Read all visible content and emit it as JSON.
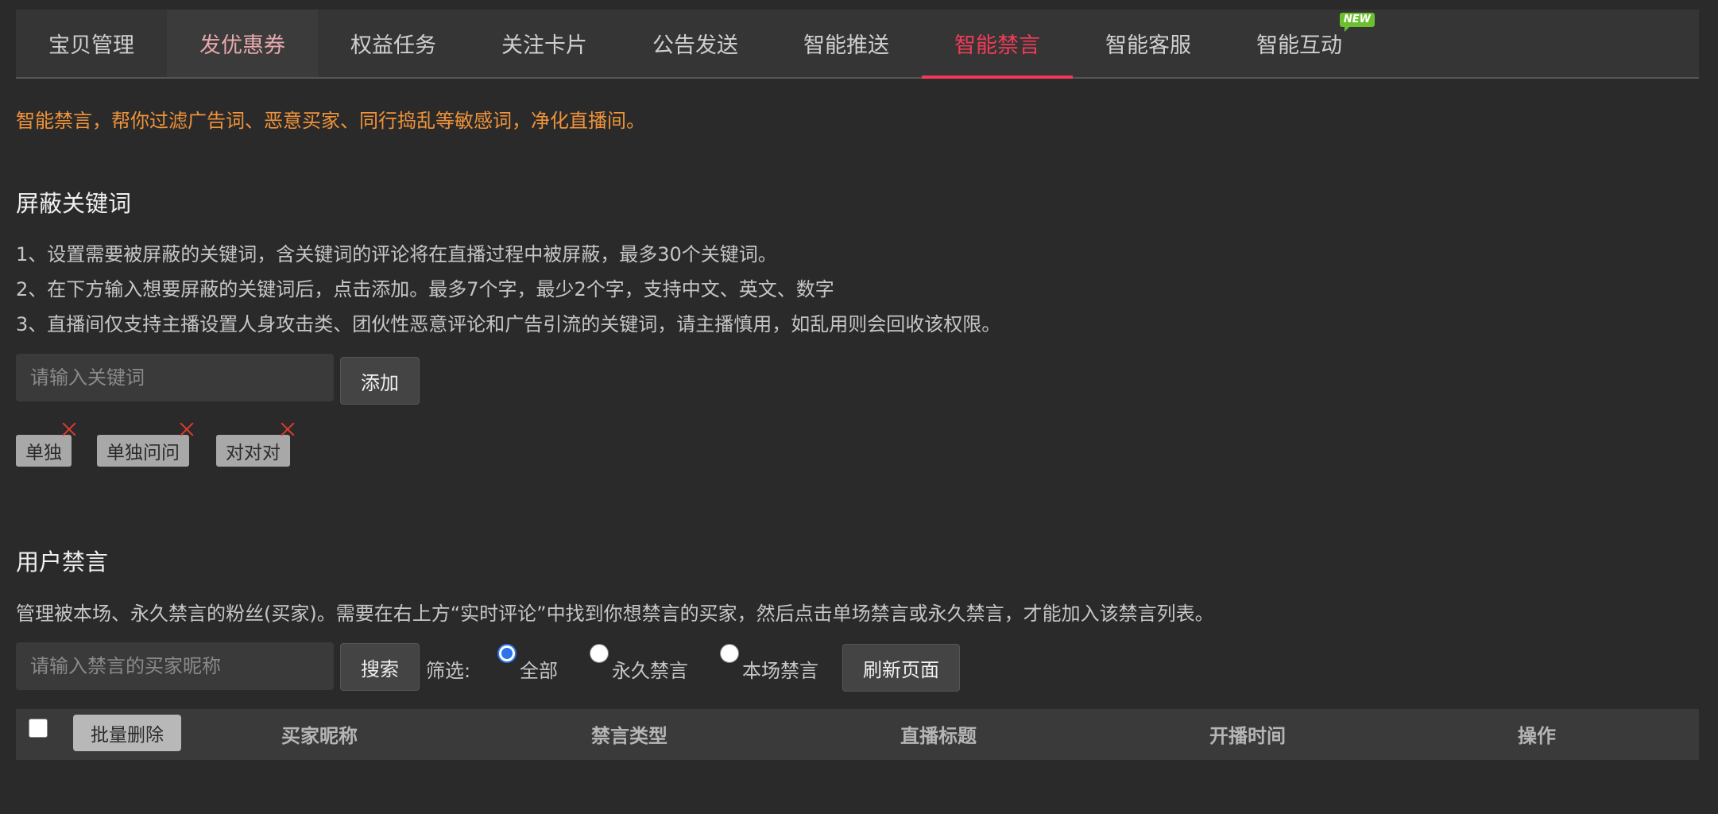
{
  "tabs": [
    {
      "label": "宝贝管理"
    },
    {
      "label": "发优惠券"
    },
    {
      "label": "权益任务"
    },
    {
      "label": "关注卡片"
    },
    {
      "label": "公告发送"
    },
    {
      "label": "智能推送"
    },
    {
      "label": "智能禁言"
    },
    {
      "label": "智能客服"
    },
    {
      "label": "智能互动",
      "badge": "NEW"
    }
  ],
  "active_tab": "智能禁言",
  "colors": {
    "accent": "#f03b57",
    "notice": "#f0933a",
    "badge": "#6cbf2f",
    "radio": "#2c74e8"
  },
  "notice": "智能禁言，帮你过滤广告词、恶意买家、同行捣乱等敏感词，净化直播间。",
  "keywords_section": {
    "title": "屏蔽关键词",
    "rules": [
      "1、设置需要被屏蔽的关键词，含关键词的评论将在直播过程中被屏蔽，最多30个关键词。",
      "2、在下方输入想要屏蔽的关键词后，点击添加。最多7个字，最少2个字，支持中文、英文、数字",
      "3、直播间仅支持主播设置人身攻击类、团伙性恶意评论和广告引流的关键词，请主播慎用，如乱用则会回收该权限。"
    ],
    "input_placeholder": "请输入关键词",
    "add_label": "添加",
    "tags": [
      "单独",
      "单独问问",
      "对对对"
    ]
  },
  "ban_section": {
    "title": "用户禁言",
    "description": "管理被本场、永久禁言的粉丝(买家)。需要在右上方“实时评论”中找到你想禁言的买家，然后点击单场禁言或永久禁言，才能加入该禁言列表。",
    "search_placeholder": "请输入禁言的买家昵称",
    "search_label": "搜索",
    "filter_label": "筛选:",
    "filter_options": [
      "全部",
      "永久禁言",
      "本场禁言"
    ],
    "filter_selected": "全部",
    "refresh_label": "刷新页面",
    "table": {
      "batch_delete": "批量删除",
      "columns": [
        "买家昵称",
        "禁言类型",
        "直播标题",
        "开播时间",
        "操作"
      ]
    }
  }
}
